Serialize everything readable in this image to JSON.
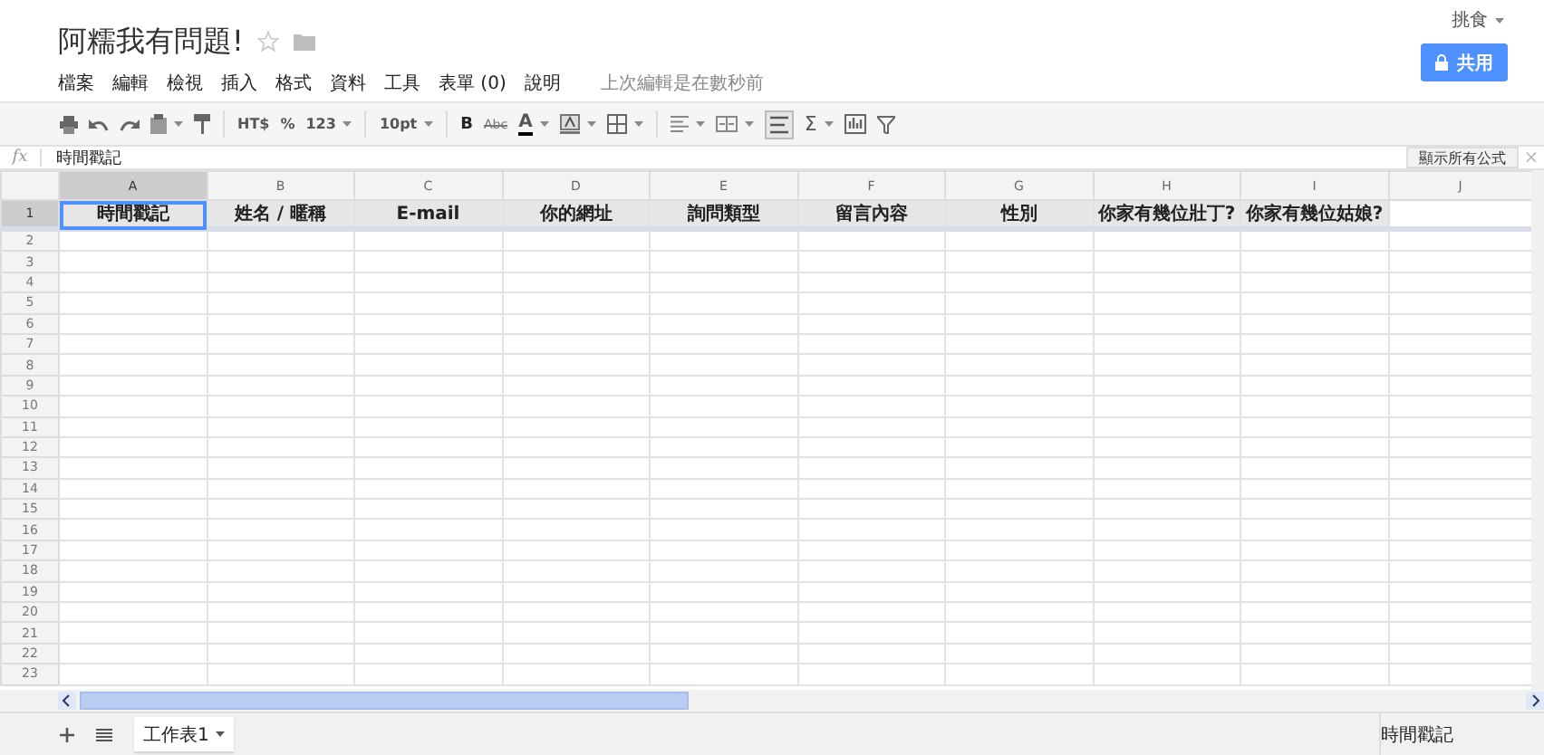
{
  "document": {
    "title": "阿糯我有問題!",
    "starred": false
  },
  "account": {
    "name": "挑食"
  },
  "share_button": "共用",
  "menu": [
    "檔案",
    "編輯",
    "檢視",
    "插入",
    "格式",
    "資料",
    "工具",
    "表單 (0)",
    "說明"
  ],
  "last_edit": "上次編輯是在數秒前",
  "toolbar": {
    "currency": "HT$",
    "percent": "%",
    "number_format": "123",
    "font_size": "10pt",
    "bold": "B",
    "strikethrough": "Abc",
    "text_color": "A",
    "sum": "Σ"
  },
  "formula_bar": {
    "label": "fx",
    "value": "時間戳記",
    "show_formulas": "顯示所有公式",
    "close": "×"
  },
  "columns": [
    {
      "label": "A",
      "selected": true
    },
    {
      "label": "B",
      "selected": false
    },
    {
      "label": "C",
      "selected": false
    },
    {
      "label": "D",
      "selected": false
    },
    {
      "label": "E",
      "selected": false
    },
    {
      "label": "F",
      "selected": false
    },
    {
      "label": "G",
      "selected": false
    },
    {
      "label": "H",
      "selected": false
    },
    {
      "label": "I",
      "selected": false
    },
    {
      "label": "J",
      "selected": false
    }
  ],
  "rows": [
    {
      "number": "1",
      "selected": true,
      "cells": [
        {
          "text": "時間戳記",
          "selected": true
        },
        {
          "text": "姓名 / 暱稱",
          "selected": false
        },
        {
          "text": "E-mail",
          "selected": false
        },
        {
          "text": "你的網址",
          "selected": false
        },
        {
          "text": "詢問類型",
          "selected": false
        },
        {
          "text": "留言內容",
          "selected": false
        },
        {
          "text": "性別",
          "selected": false
        },
        {
          "text": "你家有幾位壯丁?",
          "selected": false
        },
        {
          "text": "你家有幾位姑娘?",
          "selected": false
        }
      ]
    },
    {
      "number": "2",
      "selected": false
    },
    {
      "number": "3",
      "selected": false
    },
    {
      "number": "4",
      "selected": false
    },
    {
      "number": "5",
      "selected": false
    },
    {
      "number": "6",
      "selected": false
    },
    {
      "number": "7",
      "selected": false
    },
    {
      "number": "8",
      "selected": false
    },
    {
      "number": "9",
      "selected": false
    },
    {
      "number": "10",
      "selected": false
    },
    {
      "number": "11",
      "selected": false
    },
    {
      "number": "12",
      "selected": false
    },
    {
      "number": "13",
      "selected": false
    },
    {
      "number": "14",
      "selected": false
    },
    {
      "number": "15",
      "selected": false
    },
    {
      "number": "16",
      "selected": false
    },
    {
      "number": "17",
      "selected": false
    },
    {
      "number": "18",
      "selected": false
    },
    {
      "number": "19",
      "selected": false
    },
    {
      "number": "20",
      "selected": false
    },
    {
      "number": "21",
      "selected": false
    },
    {
      "number": "22",
      "selected": false
    },
    {
      "number": "23",
      "selected": false
    }
  ],
  "sheet_tabs": [
    {
      "label": "工作表1",
      "selected": true
    }
  ],
  "status": "時間戳記"
}
